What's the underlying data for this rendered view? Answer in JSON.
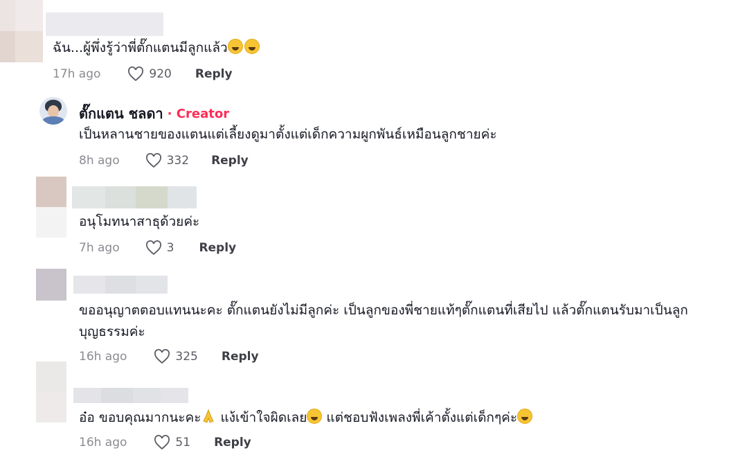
{
  "comments": [
    {
      "text": "ฉัน...ผู้พึ่งรู้ว่าพี่ตั๊กแตนมีลูกแล้ว",
      "time": "17h ago",
      "likes": "920",
      "reply": "Reply"
    },
    {
      "author": "ตั๊กแตน ชลดา",
      "badge": "· Creator",
      "text": "เป็นหลานชายของแตนแต่เลี้ยงดูมาตั้งแต่เด็กความผูกพันธ์เหมือนลูกชายค่ะ",
      "time": "8h ago",
      "likes": "332",
      "reply": "Reply"
    },
    {
      "text": "อนุโมทนาสาธุด้วยค่ะ",
      "time": "7h ago",
      "likes": "3",
      "reply": "Reply"
    },
    {
      "text_line1": "ขออนุญาตตอบแทนนะคะ ตั๊กแตนยังไม่มีลูกค่ะ เป็นลูกของพี่ชายแท้ๆตั๊กแตนที่เสียไป แล้วตั๊กแตนรับมาเป็นลูก",
      "text_line2": "บุญธรรมค่ะ",
      "time": "16h ago",
      "likes": "325",
      "reply": "Reply"
    },
    {
      "text_a": "อ๋อ ขอบคุณมากนะคะ",
      "text_b": " แง้เข้าใจผิดเลย",
      "text_c": " แต่ชอบฟังเพลงพี่เค้าตั้งแต่เด็กๆค่ะ",
      "time": "16h ago",
      "likes": "51",
      "reply": "Reply"
    }
  ],
  "icons": {
    "like": "heart-outline-icon",
    "emoji": "smiling-face-emoji",
    "pray": "folded-hands-emoji"
  },
  "colors": {
    "creator": "#fe2c55",
    "meta": "#8a8b91"
  }
}
